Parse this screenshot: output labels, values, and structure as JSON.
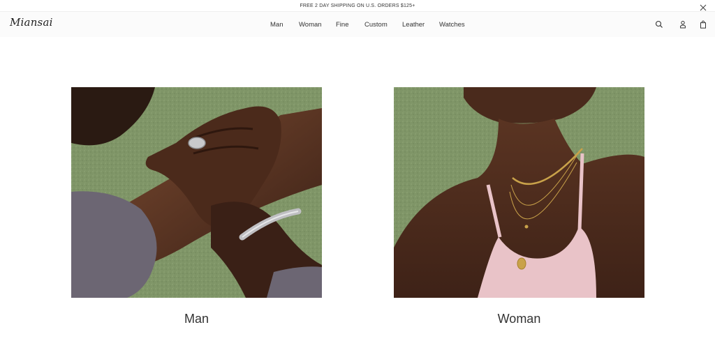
{
  "promo": {
    "text": "FREE 2 DAY SHIPPING ON U.S. ORDERS $125+",
    "close_icon": "close-icon"
  },
  "header": {
    "logo": "Miansai",
    "nav": [
      "Man",
      "Woman",
      "Fine",
      "Custom",
      "Leather",
      "Watches"
    ],
    "icons": [
      "search-icon",
      "account-icon",
      "bag-icon"
    ]
  },
  "tiles": [
    {
      "label": "Man",
      "image": "man-jewelry-photo"
    },
    {
      "label": "Woman",
      "image": "woman-jewelry-photo"
    }
  ],
  "colors": {
    "grass": "#7f9567",
    "skin": "#5a3422",
    "top_pink": "#e9c3c8",
    "sleeve_gray": "#6c6673",
    "gold": "#c9a24a",
    "silver": "#bfbfc2"
  }
}
